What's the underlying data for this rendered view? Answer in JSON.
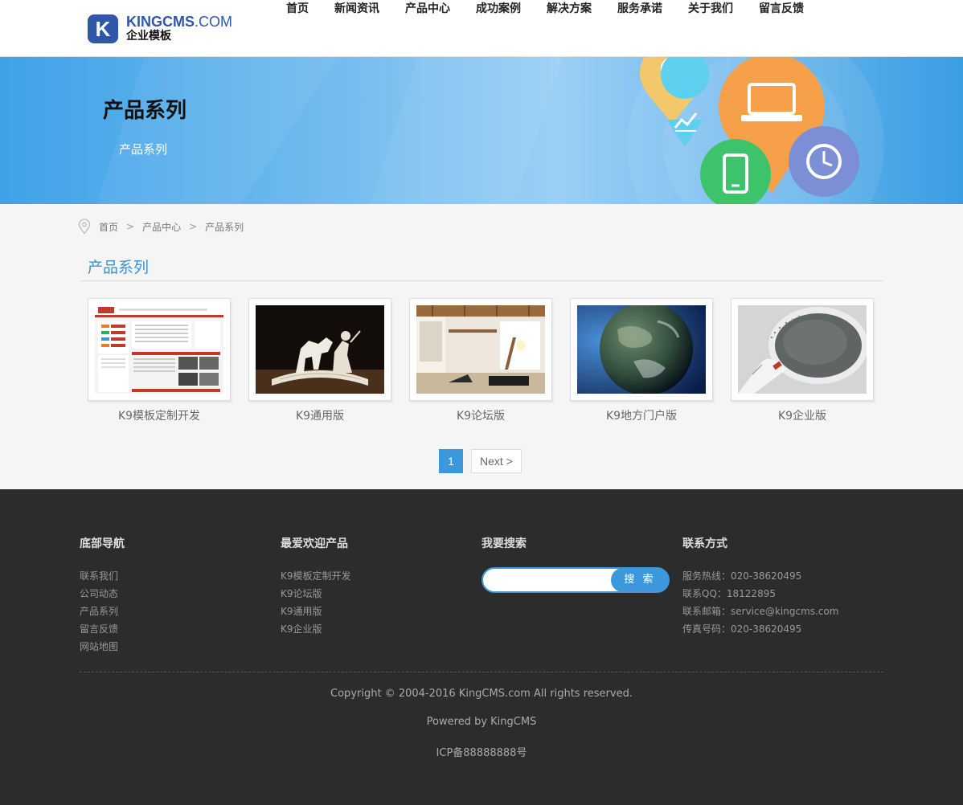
{
  "header": {
    "logo_letter": "K",
    "logo_brand": "KINGCMS",
    "logo_domain": ".COM",
    "logo_sub": "企业模板",
    "nav": [
      "首页",
      "新闻资讯",
      "产品中心",
      "成功案例",
      "解决方案",
      "服务承诺",
      "关于我们",
      "留言反馈"
    ]
  },
  "banner": {
    "title": "产品系列",
    "subtitle": "产品系列",
    "colors": {
      "orange": "#f7a04a",
      "yellow": "#f2c86a",
      "green": "#3dc46a",
      "cyan": "#5dd0f0",
      "purple": "#7b8ed6"
    }
  },
  "breadcrumb": {
    "items": [
      "首页",
      "产品中心",
      "产品系列"
    ],
    "separator": ">"
  },
  "section": {
    "title": "产品系列"
  },
  "products": [
    {
      "name": "K9模板定制开发",
      "image": "webpage-screenshot"
    },
    {
      "name": "K9通用版",
      "image": "paper-horse-book"
    },
    {
      "name": "K9论坛版",
      "image": "interior-loft"
    },
    {
      "name": "K9地方门户版",
      "image": "earth-globe"
    },
    {
      "name": "K9企业版",
      "image": "frying-pan"
    }
  ],
  "pagination": {
    "current": "1",
    "next": "Next >"
  },
  "footer": {
    "nav_title": "底部导航",
    "nav_links": [
      "联系我们",
      "公司动态",
      "产品系列",
      "留言反馈",
      "网站地图"
    ],
    "popular_title": "最爱欢迎产品",
    "popular_links": [
      "K9模板定制开发",
      "K9论坛版",
      "K9通用版",
      "K9企业版"
    ],
    "search_title": "我要搜索",
    "search_placeholder": "",
    "search_button": "搜 索",
    "contact_title": "联系方式",
    "contact_lines": [
      "服务热线：020-38620495",
      "联系QQ：18122895",
      "联系邮箱：service@kingcms.com",
      "传真号码：020-38620495"
    ],
    "copyright": "Copyright © 2004-2016 KingCMS.com All rights reserved.",
    "powered": "Powered by KingCMS",
    "icp": "ICP备88888888号"
  },
  "accent_color": "#3d97db"
}
